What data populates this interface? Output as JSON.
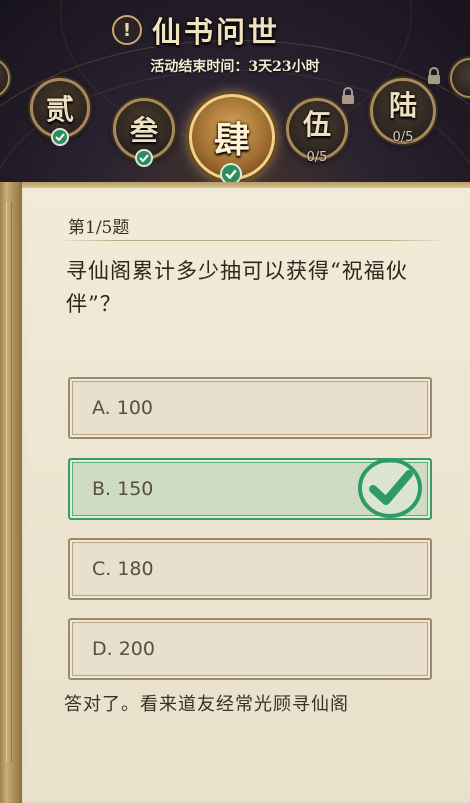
{
  "header": {
    "title": "仙书问世",
    "alert_icon": "exclamation-icon",
    "countdown_label": "活动结束时间：3天23小时"
  },
  "chapters": [
    {
      "name": "贰",
      "state": "completed",
      "icon": "check-icon"
    },
    {
      "name": "叁",
      "state": "completed",
      "icon": "check-icon"
    },
    {
      "name": "肆",
      "state": "current-completed",
      "icon": "check-icon"
    },
    {
      "name": "伍",
      "state": "locked",
      "progress": "0/5",
      "icon": "lock-icon"
    },
    {
      "name": "陆",
      "state": "locked",
      "progress": "0/5",
      "icon": "lock-icon"
    }
  ],
  "quiz": {
    "question_number": "第1/5题",
    "question": "寻仙阁累计多少抽可以获得“祝福伙伴”？",
    "options": [
      {
        "label": "A. 100",
        "state": "default"
      },
      {
        "label": "B. 150",
        "state": "correct"
      },
      {
        "label": "C. 180",
        "state": "default"
      },
      {
        "label": "D. 200",
        "state": "default"
      }
    ],
    "feedback": "答对了。看来道友经常光顾寻仙阁"
  },
  "colors": {
    "correct_green": "#2f9a68",
    "paper": "#eee7d4",
    "gold": "#c9a86a",
    "text_dark": "#2f261d"
  }
}
